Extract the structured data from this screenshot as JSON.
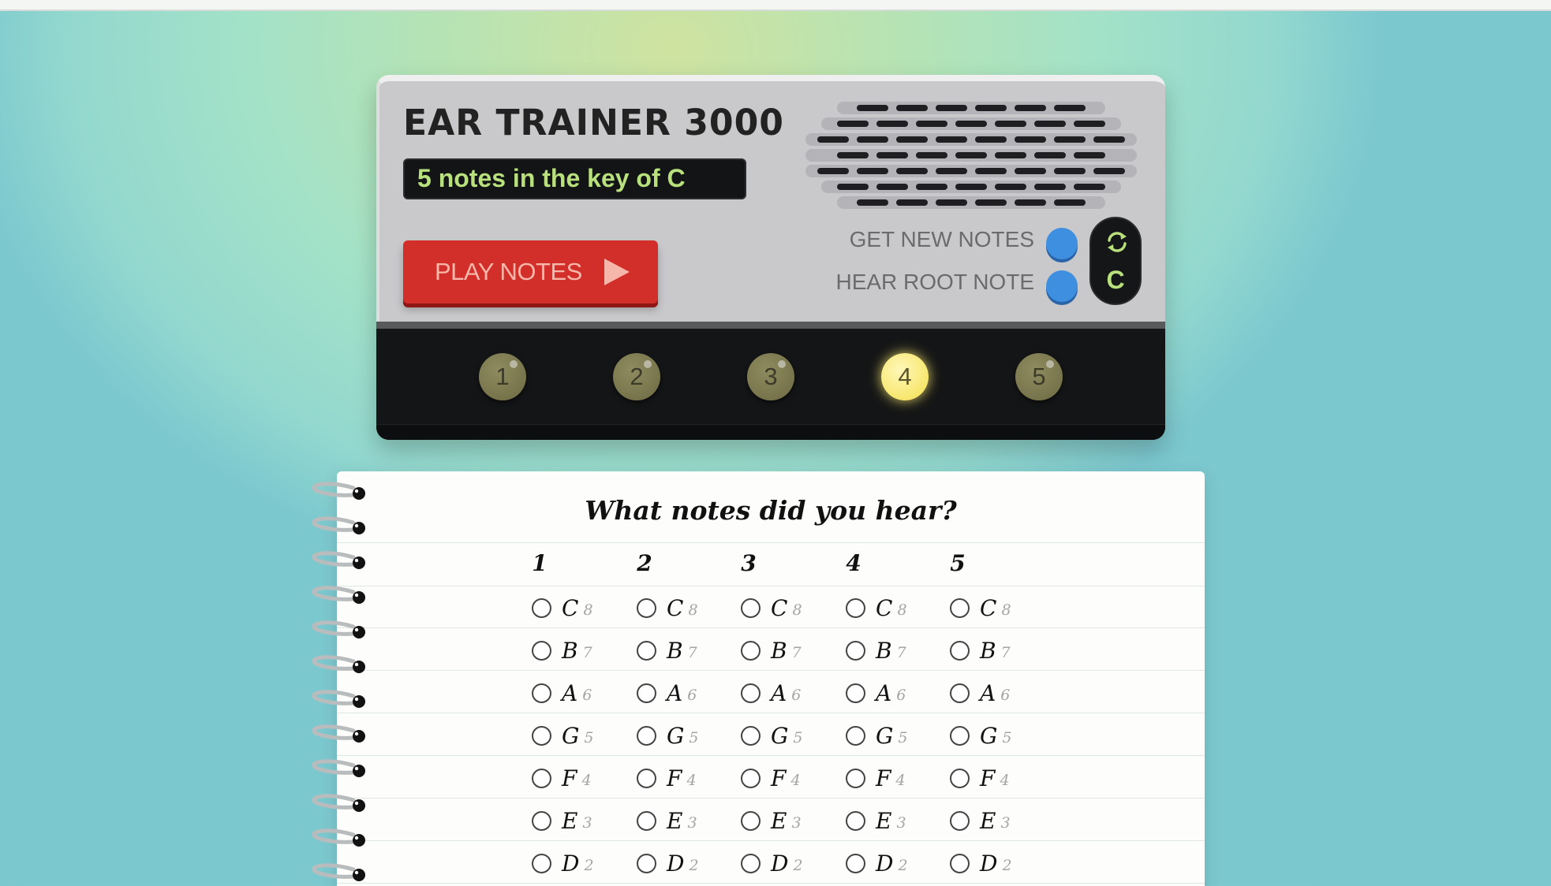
{
  "device": {
    "title": "EAR TRAINER 3000",
    "screen_text": "5 notes in the key of C",
    "play_button_label": "PLAY NOTES",
    "get_new_notes_label": "GET NEW NOTES",
    "hear_root_note_label": "HEAR ROOT NOTE",
    "root_note": "C",
    "accent_color": "#b8e07c",
    "play_button_color": "#d22e2a",
    "knob_color": "#3f8fe0",
    "indicators": [
      {
        "label": "1",
        "lit": false
      },
      {
        "label": "2",
        "lit": false
      },
      {
        "label": "3",
        "lit": false
      },
      {
        "label": "4",
        "lit": true
      },
      {
        "label": "5",
        "lit": false
      }
    ]
  },
  "notebook": {
    "title": "What notes did you hear?",
    "columns": [
      "1",
      "2",
      "3",
      "4",
      "5"
    ],
    "options": [
      {
        "note": "C",
        "degree": "8"
      },
      {
        "note": "B",
        "degree": "7"
      },
      {
        "note": "A",
        "degree": "6"
      },
      {
        "note": "G",
        "degree": "5"
      },
      {
        "note": "F",
        "degree": "4"
      },
      {
        "note": "E",
        "degree": "3"
      },
      {
        "note": "D",
        "degree": "2"
      }
    ]
  }
}
